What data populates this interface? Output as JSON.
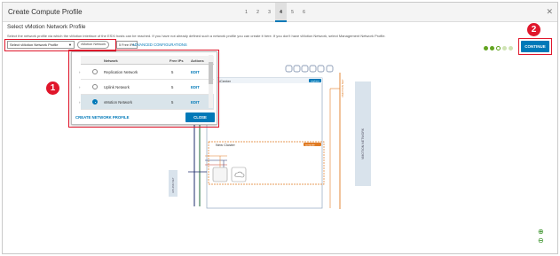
{
  "dialog": {
    "title": "Create Compute Profile",
    "steps": [
      "1",
      "2",
      "3",
      "4",
      "5",
      "6"
    ],
    "active_step": "4",
    "close_glyph": "✕"
  },
  "section": {
    "title": "Select vMotion Network Profile",
    "description": "Select the network profile via which the vMotion interface of the ESXi hosts can be reached. If you have not already defined such a network profile you can create it here. If you don't have vMotion Network, select Management Network Profile."
  },
  "controls": {
    "profile_select": "Select vMotion Network Profile",
    "selected_tag": "vMotion Network",
    "free_ips": "5 Free IPs",
    "advanced": "ADVANCED CONFIGURATIONS",
    "continue": "CONTINUE"
  },
  "progress": {
    "dots": [
      "done",
      "done",
      "ring",
      "light",
      "light"
    ]
  },
  "popup": {
    "columns": [
      "Network",
      "Free IPs",
      "Actions"
    ],
    "rows": [
      {
        "name": "Replication Network",
        "free_ips": "5",
        "action": "EDIT",
        "selected": false
      },
      {
        "name": "Uplink Network",
        "free_ips": "5",
        "action": "EDIT",
        "selected": false
      },
      {
        "name": "vMotion Network",
        "free_ips": "5",
        "action": "EDIT",
        "selected": true
      }
    ],
    "create_link": "CREATE NETWORK PROFILE",
    "close_label": "CLOSE"
  },
  "annotations": {
    "callout_1": "1",
    "callout_2": "2"
  },
  "diagram": {
    "vcenter_label": "vCenter",
    "vcenter_badge": "vsphere",
    "cluster_label": "New Cluster",
    "cluster_badge": "compute",
    "vertical_right": "VMOTION NETWORK",
    "vertical_left": "UPLINK NET",
    "vertical_mid": "VMOTION NET"
  },
  "colors": {
    "accent": "#0079b8",
    "annotation": "#e0162b",
    "green": "#62a420",
    "orange": "#e07b24"
  }
}
